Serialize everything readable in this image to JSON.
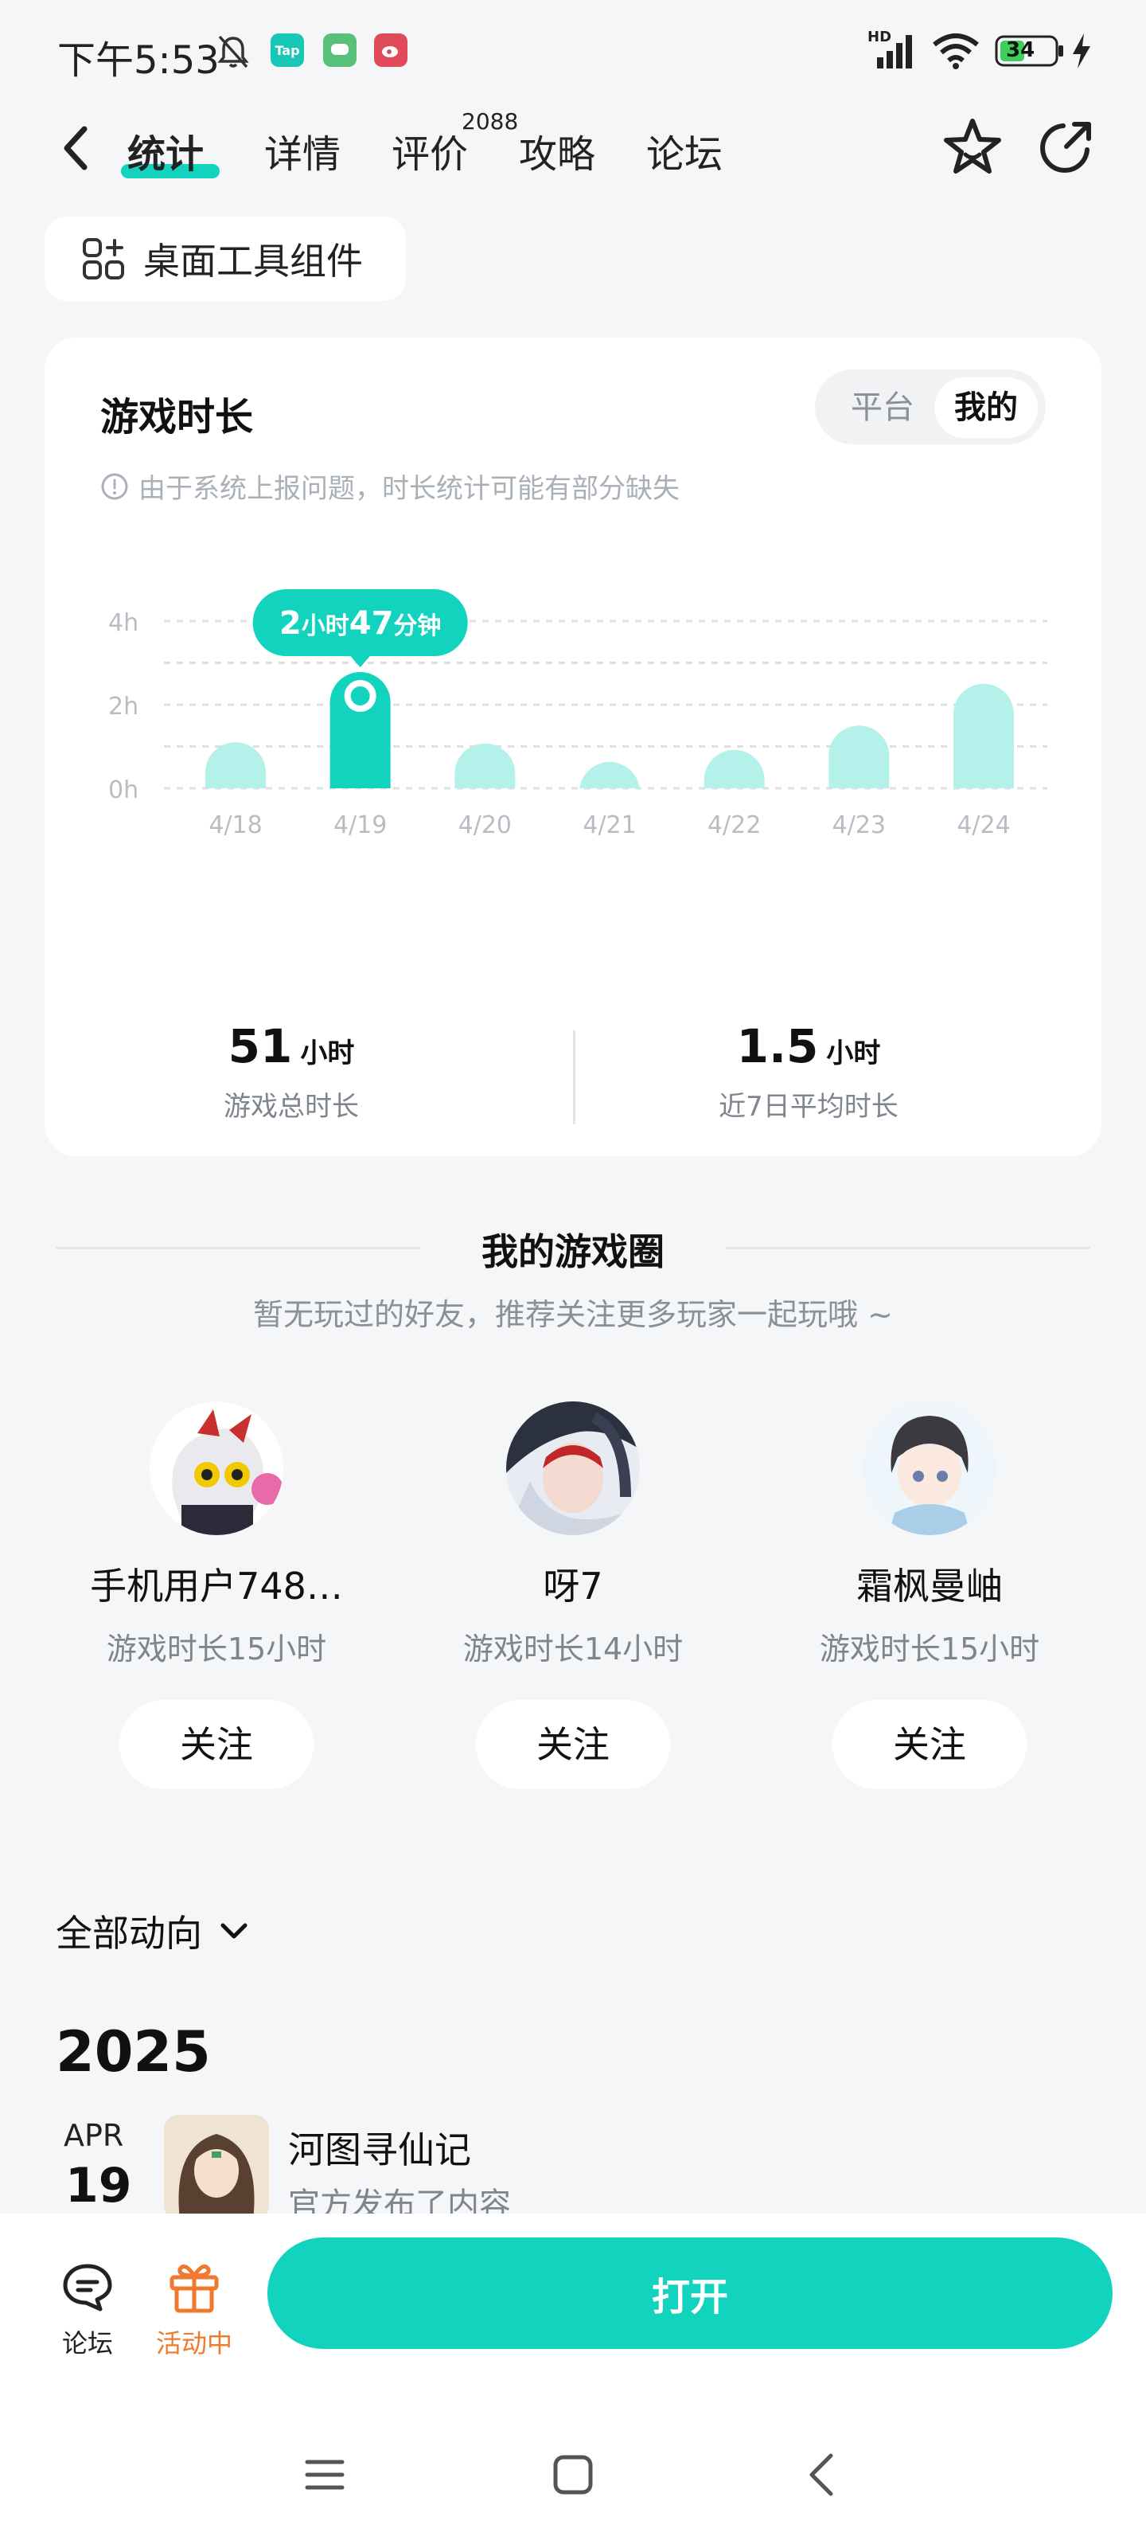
{
  "status_bar": {
    "time": "下午5:53",
    "battery": "34",
    "network": "HD",
    "badges": [
      {
        "label": "Tap",
        "color": "#19c7b6"
      },
      {
        "label": "",
        "color": "#59c07a"
      },
      {
        "label": "",
        "color": "#e04a5a"
      }
    ]
  },
  "nav": {
    "tabs": [
      "统计",
      "详情",
      "评价",
      "攻略",
      "论坛"
    ],
    "active_tab": "统计",
    "review_count": "2088"
  },
  "widget_button": "桌面工具组件",
  "playtime": {
    "title": "游戏时长",
    "toggle": {
      "platform": "平台",
      "mine": "我的",
      "selected": "我的"
    },
    "notice": "由于系统上报问题，时长统计可能有部分缺失",
    "total_value": "51",
    "total_unit": "小时",
    "total_label": "游戏总时长",
    "avg_value": "1.5",
    "avg_unit": "小时",
    "avg_label": "近7日平均时长"
  },
  "chart_data": {
    "type": "bar",
    "categories": [
      "4/18",
      "4/19",
      "4/20",
      "4/21",
      "4/22",
      "4/23",
      "4/24"
    ],
    "values": [
      1.1,
      2.78,
      1.07,
      0.63,
      0.92,
      1.5,
      2.5
    ],
    "y_unit": "h",
    "y_ticks": [
      "0h",
      "2h",
      "4h"
    ],
    "ylim": [
      0,
      4
    ],
    "grid": "dashed",
    "highlight_index": 1,
    "highlight_label_num1": "2",
    "highlight_label_unit1": "小时",
    "highlight_label_num2": "47",
    "highlight_label_unit2": "分钟",
    "colors": {
      "highlight": "#12d3bd",
      "normal": "#b3f1ea"
    }
  },
  "game_circle": {
    "title": "我的游戏圈",
    "subtitle": "暂无玩过的好友，推荐关注更多玩家一起玩哦 ~",
    "players": [
      {
        "name": "手机用户748…",
        "time": "游戏时长15小时",
        "follow": "关注"
      },
      {
        "name": "呀7",
        "time": "游戏时长14小时",
        "follow": "关注"
      },
      {
        "name": "霜枫曼岫",
        "time": "游戏时长15小时",
        "follow": "关注"
      }
    ]
  },
  "activity": {
    "filter": "全部动向",
    "year": "2025",
    "month": "APR",
    "day": "19",
    "post_title": "河图寻仙记",
    "post_subtitle": "官方发布了内容"
  },
  "bottom_bar": {
    "forum_label": "论坛",
    "activity_label": "活动中",
    "open_label": "打开"
  },
  "accent_color": "#12d3bd"
}
